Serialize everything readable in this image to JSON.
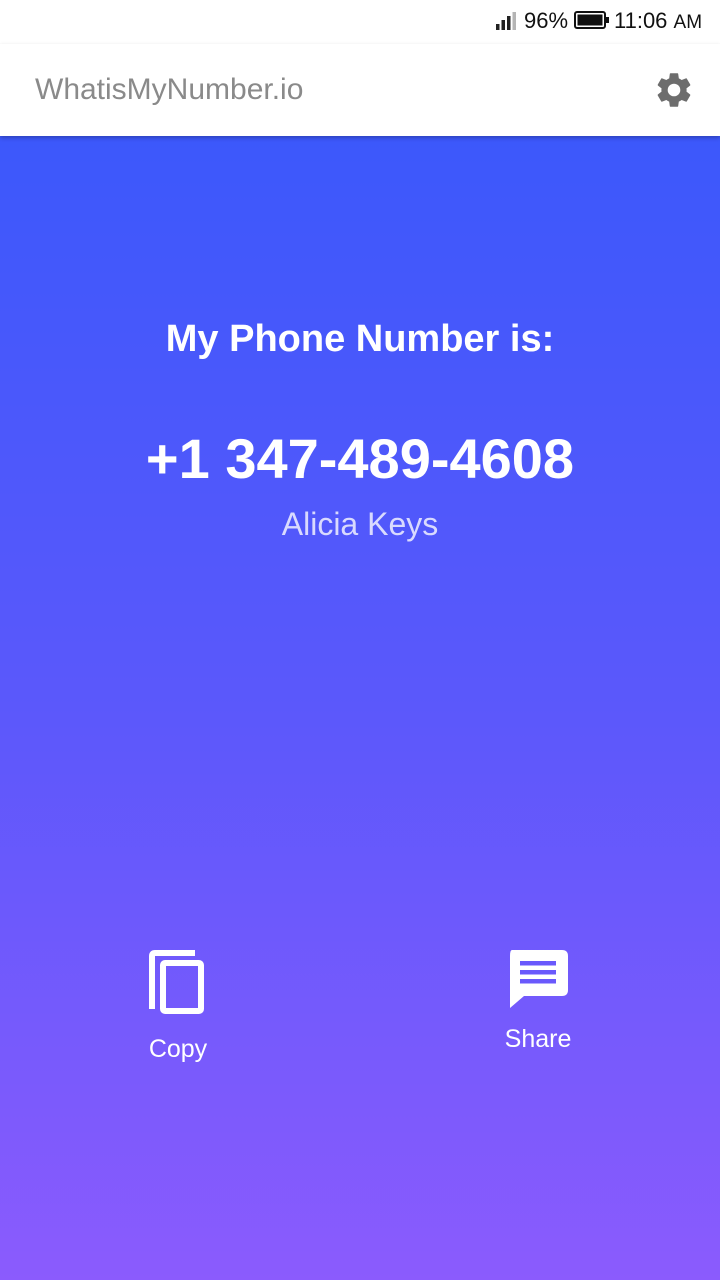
{
  "status_bar": {
    "battery_percent": "96%",
    "time": "11:06",
    "ampm": "AM",
    "icons": [
      "signal-icon",
      "battery-icon"
    ]
  },
  "app_bar": {
    "title": "WhatisMyNumber.io",
    "settings_icon": "gear-icon"
  },
  "main": {
    "heading": "My Phone Number is:",
    "phone_number": "+1 347-489-4608",
    "owner_name": "Alicia Keys",
    "actions": [
      {
        "label": "Copy",
        "icon": "copy-icon"
      },
      {
        "label": "Share",
        "icon": "message-icon"
      }
    ]
  },
  "colors": {
    "gradient_top": "#3c58fb",
    "gradient_bottom": "#8b5bfd",
    "title_gray": "#8a8a8a",
    "icon_gray": "#6d6d6d"
  }
}
